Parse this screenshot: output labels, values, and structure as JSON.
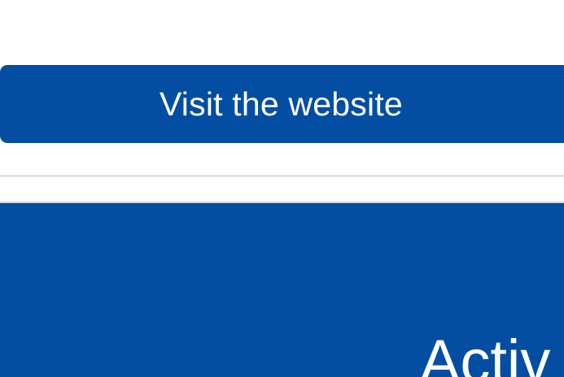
{
  "primary_action": {
    "label": "Visit the website"
  },
  "hero": {
    "title_partial": "Activ"
  },
  "colors": {
    "brand_blue": "#034ea2",
    "background": "#ffffff",
    "divider": "#e3e3e3",
    "text_on_brand": "#ffffff"
  }
}
